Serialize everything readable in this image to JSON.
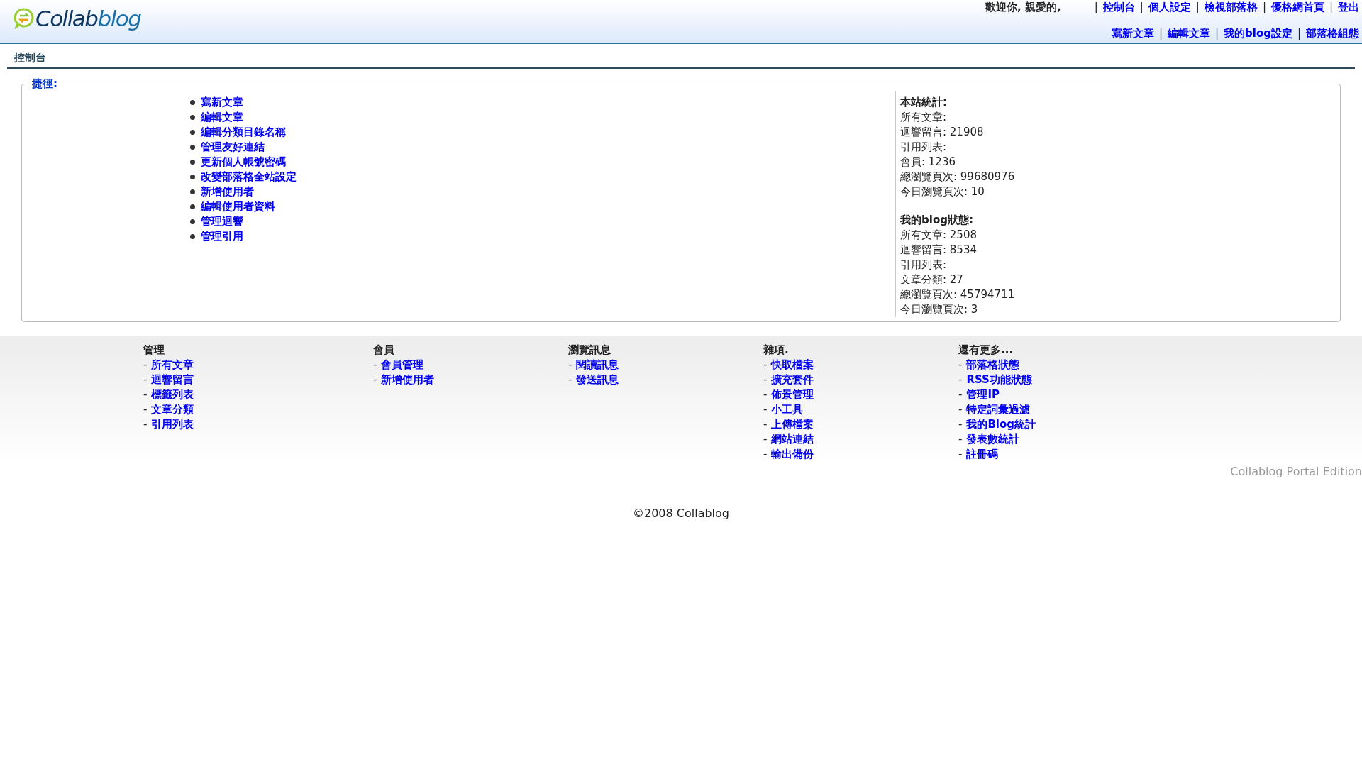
{
  "header": {
    "logo": {
      "part1": "Collab",
      "part2": "blog"
    },
    "welcome": "歡迎你, 親愛的,",
    "top_links": [
      {
        "separator": "|",
        "label": "控制台"
      },
      {
        "separator": "|",
        "label": "個人設定"
      },
      {
        "separator": "|",
        "label": "檢視部落格"
      },
      {
        "separator": "|",
        "label": "優格網首頁"
      },
      {
        "separator": "|",
        "label": "登出"
      }
    ],
    "sub_links": [
      {
        "label": "寫新文章"
      },
      {
        "separator": "|",
        "label": "編輯文章"
      },
      {
        "separator": "|",
        "label": "我的blog設定"
      },
      {
        "separator": "|",
        "label": "部落格組態"
      }
    ]
  },
  "page_title": "控制台",
  "shortcuts": {
    "legend": "捷徑:",
    "items": [
      "寫新文章",
      "編輯文章",
      "編輯分類目錄名稱",
      "管理友好連結",
      "更新個人帳號密碼",
      "改變部落格全站設定",
      "新增使用者",
      "編輯使用者資料",
      "管理迴響",
      "管理引用"
    ]
  },
  "stats": [
    {
      "title": "本站統計:",
      "lines": [
        "所有文章:",
        "迴響留言: 21908",
        "引用列表:",
        "會員: 1236",
        "總瀏覽頁次: 99680976",
        "今日瀏覽頁次: 10"
      ]
    },
    {
      "title": "我的blog狀態:",
      "lines": [
        "所有文章: 2508",
        "迴響留言: 8534",
        "引用列表:",
        "文章分類: 27",
        "總瀏覽頁次: 45794711",
        "今日瀏覽頁次: 3"
      ]
    }
  ],
  "footer_menu": [
    {
      "title": "管理",
      "items": [
        {
          "dash": "-",
          "label": "所有文章"
        },
        {
          "dash": "-",
          "label": "迴響留言"
        },
        {
          "dash": "-",
          "label": "標籤列表"
        },
        {
          "dash": "-",
          "label": "文章分類"
        },
        {
          "dash": "-",
          "label": "引用列表"
        }
      ]
    },
    {
      "title": "會員",
      "items": [
        {
          "dash": "-",
          "label": "會員管理"
        },
        {
          "dash": "-",
          "label": "新增使用者"
        }
      ]
    },
    {
      "title": "瀏覽訊息",
      "items": [
        {
          "dash": "-",
          "label": "閱讀訊息"
        },
        {
          "dash": "-",
          "label": "發送訊息"
        }
      ]
    },
    {
      "title": "雜項.",
      "items": [
        {
          "dash": "-",
          "label": "快取檔案"
        },
        {
          "dash": "-",
          "label": "擴充套件"
        },
        {
          "dash": "-",
          "label": "佈景管理"
        },
        {
          "dash": "-",
          "label": "小工具"
        },
        {
          "dash": "-",
          "label": "上傳檔案"
        },
        {
          "dash": "-",
          "label": "網站連結"
        },
        {
          "dash": "-",
          "label": "輸出備份"
        }
      ]
    },
    {
      "title": "還有更多...",
      "items": [
        {
          "dash": "-",
          "label": "部落格狀態"
        },
        {
          "dash": "-",
          "label": "RSS功能狀態"
        },
        {
          "dash": "-",
          "label": "管理IP"
        },
        {
          "dash": "-",
          "label": "特定詞彙過濾"
        },
        {
          "dash": "-",
          "label": "我的Blog統計"
        },
        {
          "dash": "-",
          "label": "發表數統計"
        },
        {
          "dash": "-",
          "label": "註冊碼"
        }
      ]
    }
  ],
  "edition": "Collablog Portal Edition",
  "copyright": "©2008 Collablog"
}
